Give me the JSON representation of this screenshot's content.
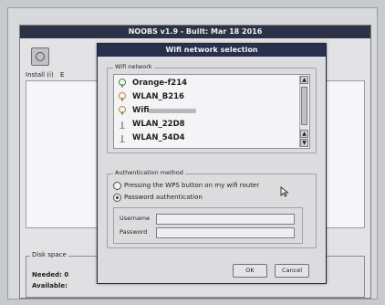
{
  "noobs": {
    "title": "NOOBS v1.9 - Built: Mar 18 2016",
    "toolbar": {
      "install_label": "Install (i)",
      "second_label": "E"
    },
    "disk_space": {
      "legend": "Disk space",
      "needed_label": "Needed: 0",
      "available_label": "Available:"
    }
  },
  "dialog": {
    "title": "Wifi network selection",
    "wifi_group_label": "Wifi network",
    "networks": [
      {
        "name": "Orange-f214",
        "icon": "wifi-signal-icon"
      },
      {
        "name": "WLAN_B216",
        "icon": "wifi-signal-icon"
      },
      {
        "name": "Wifi",
        "icon": "wifi-signal-icon"
      },
      {
        "name": "WLAN_22D8",
        "icon": "wifi-signal-icon"
      },
      {
        "name": "WLAN_54D4",
        "icon": "wifi-signal-icon"
      }
    ],
    "auth_group_label": "Authentication method",
    "auth_options": [
      {
        "label": "Pressing the WPS button on my wifi router",
        "selected": false
      },
      {
        "label": "Password authentication",
        "selected": true
      }
    ],
    "username_label": "Username",
    "password_label": "Password",
    "username_value": "",
    "password_value": "",
    "ok_label": "OK",
    "cancel_label": "Cancel"
  },
  "colors": {
    "titlebar": "#28304e",
    "dialog_bg": "#dcdcdf"
  }
}
